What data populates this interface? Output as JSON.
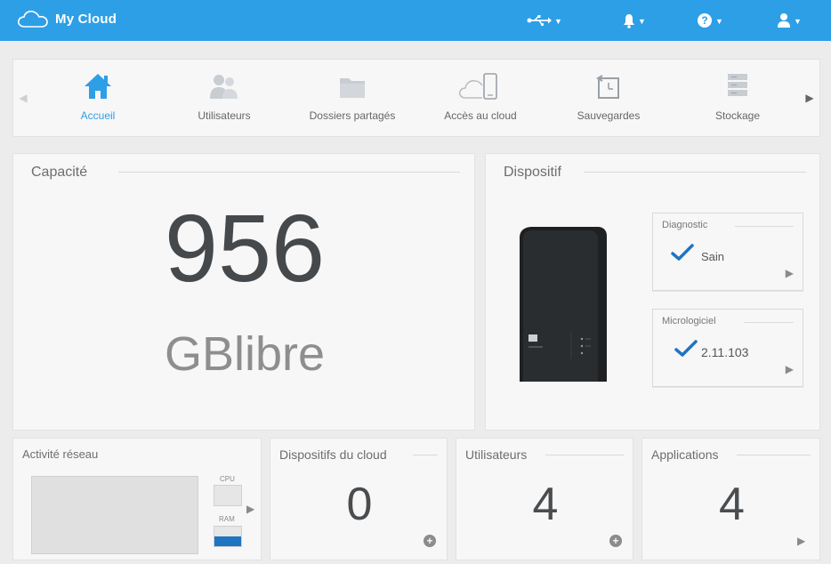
{
  "header": {
    "brand": "My Cloud",
    "icons": [
      "usb-icon",
      "bell-icon",
      "help-icon",
      "user-icon"
    ]
  },
  "nav": {
    "items": [
      {
        "label": "Accueil",
        "icon": "home-icon",
        "active": true
      },
      {
        "label": "Utilisateurs",
        "icon": "users-icon",
        "active": false
      },
      {
        "label": "Dossiers partagés",
        "icon": "folder-icon",
        "active": false
      },
      {
        "label": "Accès au cloud",
        "icon": "cloud-device-icon",
        "active": false
      },
      {
        "label": "Sauvegardes",
        "icon": "backup-icon",
        "active": false
      },
      {
        "label": "Stockage",
        "icon": "storage-icon",
        "active": false
      }
    ]
  },
  "capacity": {
    "title": "Capacité",
    "value": "956",
    "unit": "GBlibre"
  },
  "device": {
    "title": "Dispositif",
    "diagnostic": {
      "title": "Diagnostic",
      "status": "Sain"
    },
    "firmware": {
      "title": "Micrologiciel",
      "version": "2.11.103"
    }
  },
  "network": {
    "title": "Activité réseau",
    "cpu_label": "CPU",
    "ram_label": "RAM",
    "cpu_fraction": 0.0,
    "ram_fraction": 0.5
  },
  "cloud_devices": {
    "title": "Dispositifs du cloud",
    "count": "0"
  },
  "users": {
    "title": "Utilisateurs",
    "count": "4"
  },
  "apps": {
    "title": "Applications",
    "count": "4"
  },
  "colors": {
    "header_bg": "#2d9fe6",
    "accent": "#2d9fe6",
    "check": "#1f74c2",
    "panel_bg": "#f7f7f7",
    "page_bg": "#ececec"
  }
}
